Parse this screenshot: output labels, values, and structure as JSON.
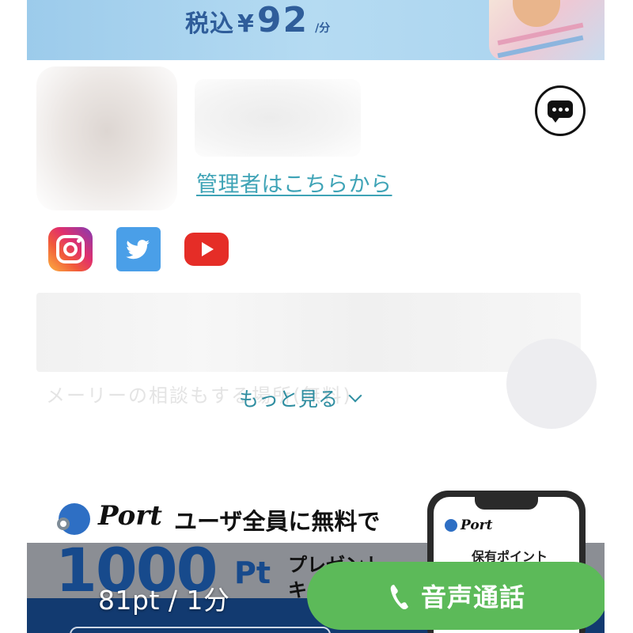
{
  "banner": {
    "tax_label": "税込",
    "currency": "¥",
    "price": "92",
    "unit": "/分"
  },
  "profile": {
    "admin_link": "管理者はこちらから"
  },
  "social": {
    "icons": [
      "instagram-icon",
      "twitter-icon",
      "youtube-icon"
    ]
  },
  "description": {
    "faded_text": "メーリーの相談もする場所(無料)",
    "see_more": "もっと見る"
  },
  "ad": {
    "brand": "Port",
    "tagline": "ユーザ全員に無料で",
    "amount": "1000",
    "amount_unit": "Pt",
    "present_line1": "プレゼント",
    "present_line2": "キ",
    "phone_brand": "Port",
    "phone_points_label": "保有ポイント"
  },
  "call_bar": {
    "rate": "81pt / 1分",
    "call_button": "音声通話"
  },
  "colors": {
    "banner_bg": "#a9d3ef",
    "price_text": "#2f5d9a",
    "link": "#3ea3b6",
    "call_green": "#5cba59",
    "promo_blue": "#174a8c"
  }
}
